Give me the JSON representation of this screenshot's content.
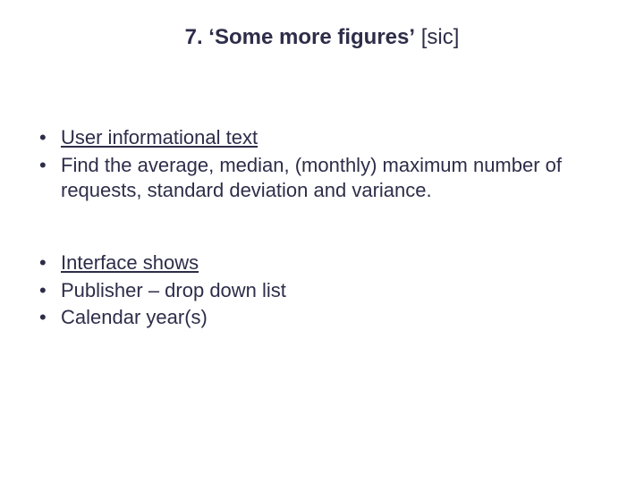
{
  "title": {
    "prefix": "7. ",
    "quoted": "‘Some more figures’",
    "sic": " [sic]"
  },
  "block1": {
    "heading": "User informational text",
    "item1": "Find the average, median, (monthly) maximum number of requests, standard deviation and variance."
  },
  "block2": {
    "heading": "Interface shows",
    "item1": "Publisher – drop down list",
    "item2": "Calendar year(s)"
  }
}
